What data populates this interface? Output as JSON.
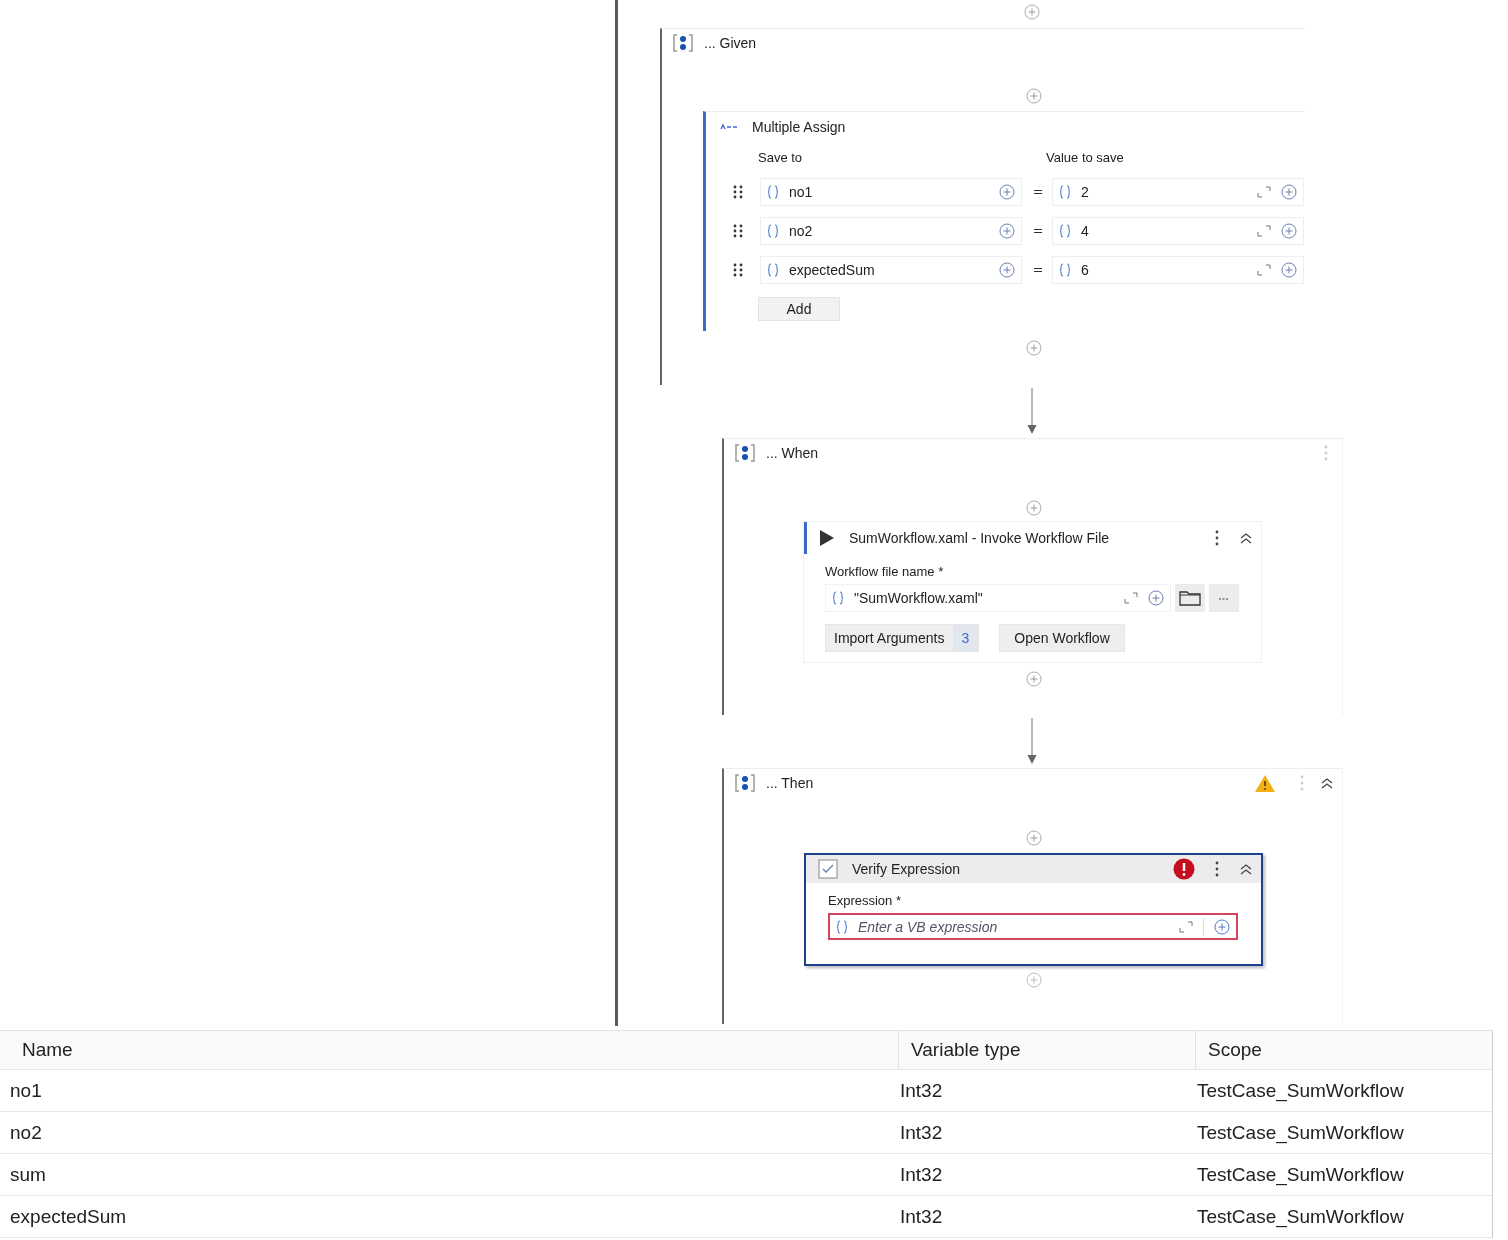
{
  "given": {
    "title": "... Given",
    "activity": {
      "title": "Multiple Assign",
      "headers": [
        "Save to",
        "Value to save"
      ],
      "rows": [
        {
          "target": "no1",
          "value": "2"
        },
        {
          "target": "no2",
          "value": "4"
        },
        {
          "target": "expectedSum",
          "value": "6"
        }
      ],
      "add_label": "Add"
    }
  },
  "when": {
    "title": "... When",
    "activity": {
      "title": "SumWorkflow.xaml - Invoke Workflow File",
      "field_label": "Workflow file name *",
      "field_value": "\"SumWorkflow.xaml\"",
      "import_label": "Import Arguments",
      "import_count": "3",
      "open_label": "Open Workflow"
    }
  },
  "then": {
    "title": "... Then",
    "warning": true,
    "activity": {
      "title": "Verify Expression",
      "error": true,
      "field_label": "Expression *",
      "placeholder": "Enter a VB expression"
    }
  },
  "variables": {
    "columns": [
      "Name",
      "Variable type",
      "Scope"
    ],
    "rows": [
      [
        "no1",
        "Int32",
        "TestCase_SumWorkflow"
      ],
      [
        "no2",
        "Int32",
        "TestCase_SumWorkflow"
      ],
      [
        "sum",
        "Int32",
        "TestCase_SumWorkflow"
      ],
      [
        "expectedSum",
        "Int32",
        "TestCase_SumWorkflow"
      ]
    ]
  }
}
